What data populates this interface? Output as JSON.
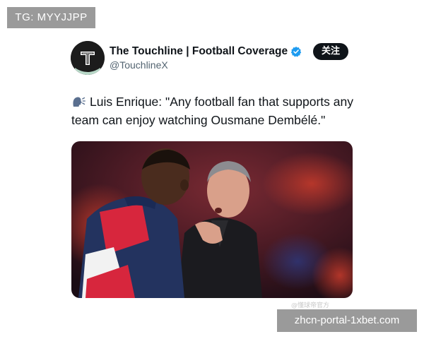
{
  "watermarks": {
    "top_left": "TG: MYYJJPP",
    "bottom_right": "zhcn-portal-1xbet.com",
    "photo_caption": "@懂球帝官方"
  },
  "tweet": {
    "avatar_icon": "touchline-logo-icon",
    "display_name": "The Touchline | Football Coverage",
    "handle": "@TouchlineX",
    "verified": true,
    "follow_label": "关注",
    "emoji_icon": "speaking-head-icon",
    "text": "Luis Enrique: \"Any football fan that supports any team can enjoy watching Ousmane Dembélé.\""
  },
  "colors": {
    "accent_blue": "#1d9bf0",
    "button_bg": "#0f1419",
    "handle_gray": "#536471",
    "watermark_gray": "#9a9a9a"
  }
}
